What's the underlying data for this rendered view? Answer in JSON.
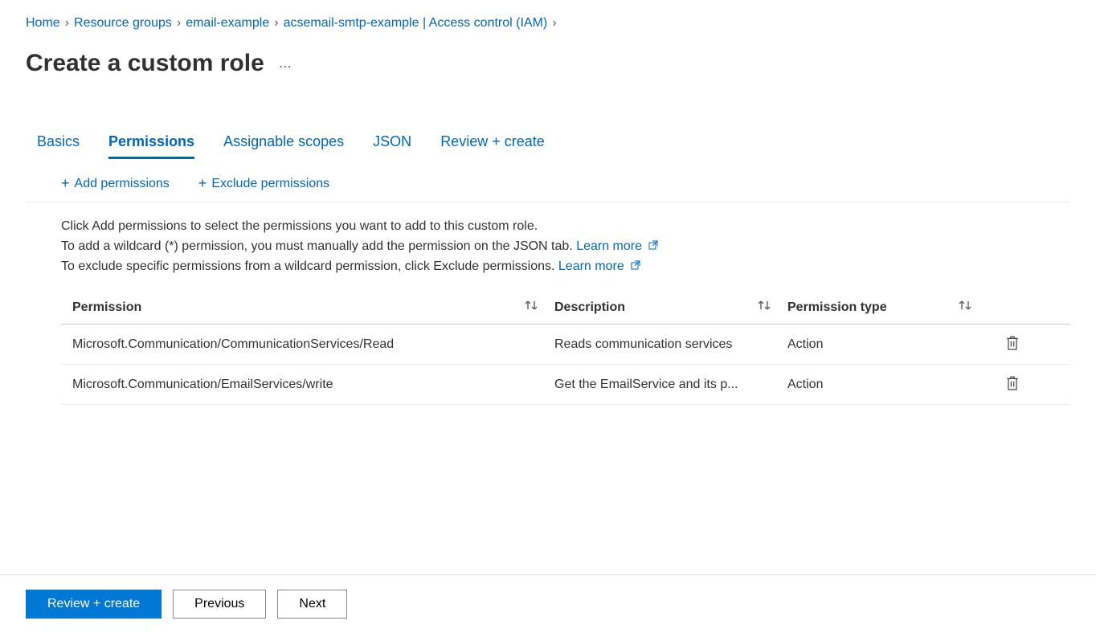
{
  "breadcrumb": [
    {
      "label": "Home"
    },
    {
      "label": "Resource groups"
    },
    {
      "label": "email-example"
    },
    {
      "label": "acsemail-smtp-example | Access control (IAM)"
    }
  ],
  "page_title": "Create a custom role",
  "tabs": {
    "basics": "Basics",
    "permissions": "Permissions",
    "assignable_scopes": "Assignable scopes",
    "json": "JSON",
    "review_create": "Review + create"
  },
  "actions": {
    "add_permissions": "Add permissions",
    "exclude_permissions": "Exclude permissions"
  },
  "intro": {
    "line1": "Click Add permissions to select the permissions you want to add to this custom role.",
    "line2_pre": "To add a wildcard (*) permission, you must manually add the permission on the JSON tab. ",
    "line3_pre": "To exclude specific permissions from a wildcard permission, click Exclude permissions. ",
    "learn_more": "Learn more"
  },
  "table": {
    "columns": {
      "permission": "Permission",
      "description": "Description",
      "permission_type": "Permission type"
    },
    "rows": [
      {
        "permission": "Microsoft.Communication/CommunicationServices/Read",
        "description": "Reads communication services",
        "permission_type": "Action"
      },
      {
        "permission": "Microsoft.Communication/EmailServices/write",
        "description": "Get the EmailService and its p...",
        "permission_type": "Action"
      }
    ]
  },
  "footer": {
    "review_create": "Review + create",
    "previous": "Previous",
    "next": "Next"
  }
}
